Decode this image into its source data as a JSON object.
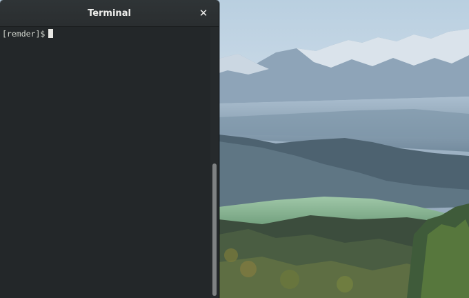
{
  "window": {
    "title": "Terminal",
    "close_glyph": "✕"
  },
  "terminal": {
    "prompt": "[remder]$"
  },
  "scrollbar": {
    "position_fraction": 0.5
  },
  "icons": {
    "close": "close-icon"
  },
  "colors": {
    "terminal_background": "#232729",
    "titlebar": "#2c3032",
    "text": "#d3d7cf",
    "cursor": "#e8e8e4"
  }
}
